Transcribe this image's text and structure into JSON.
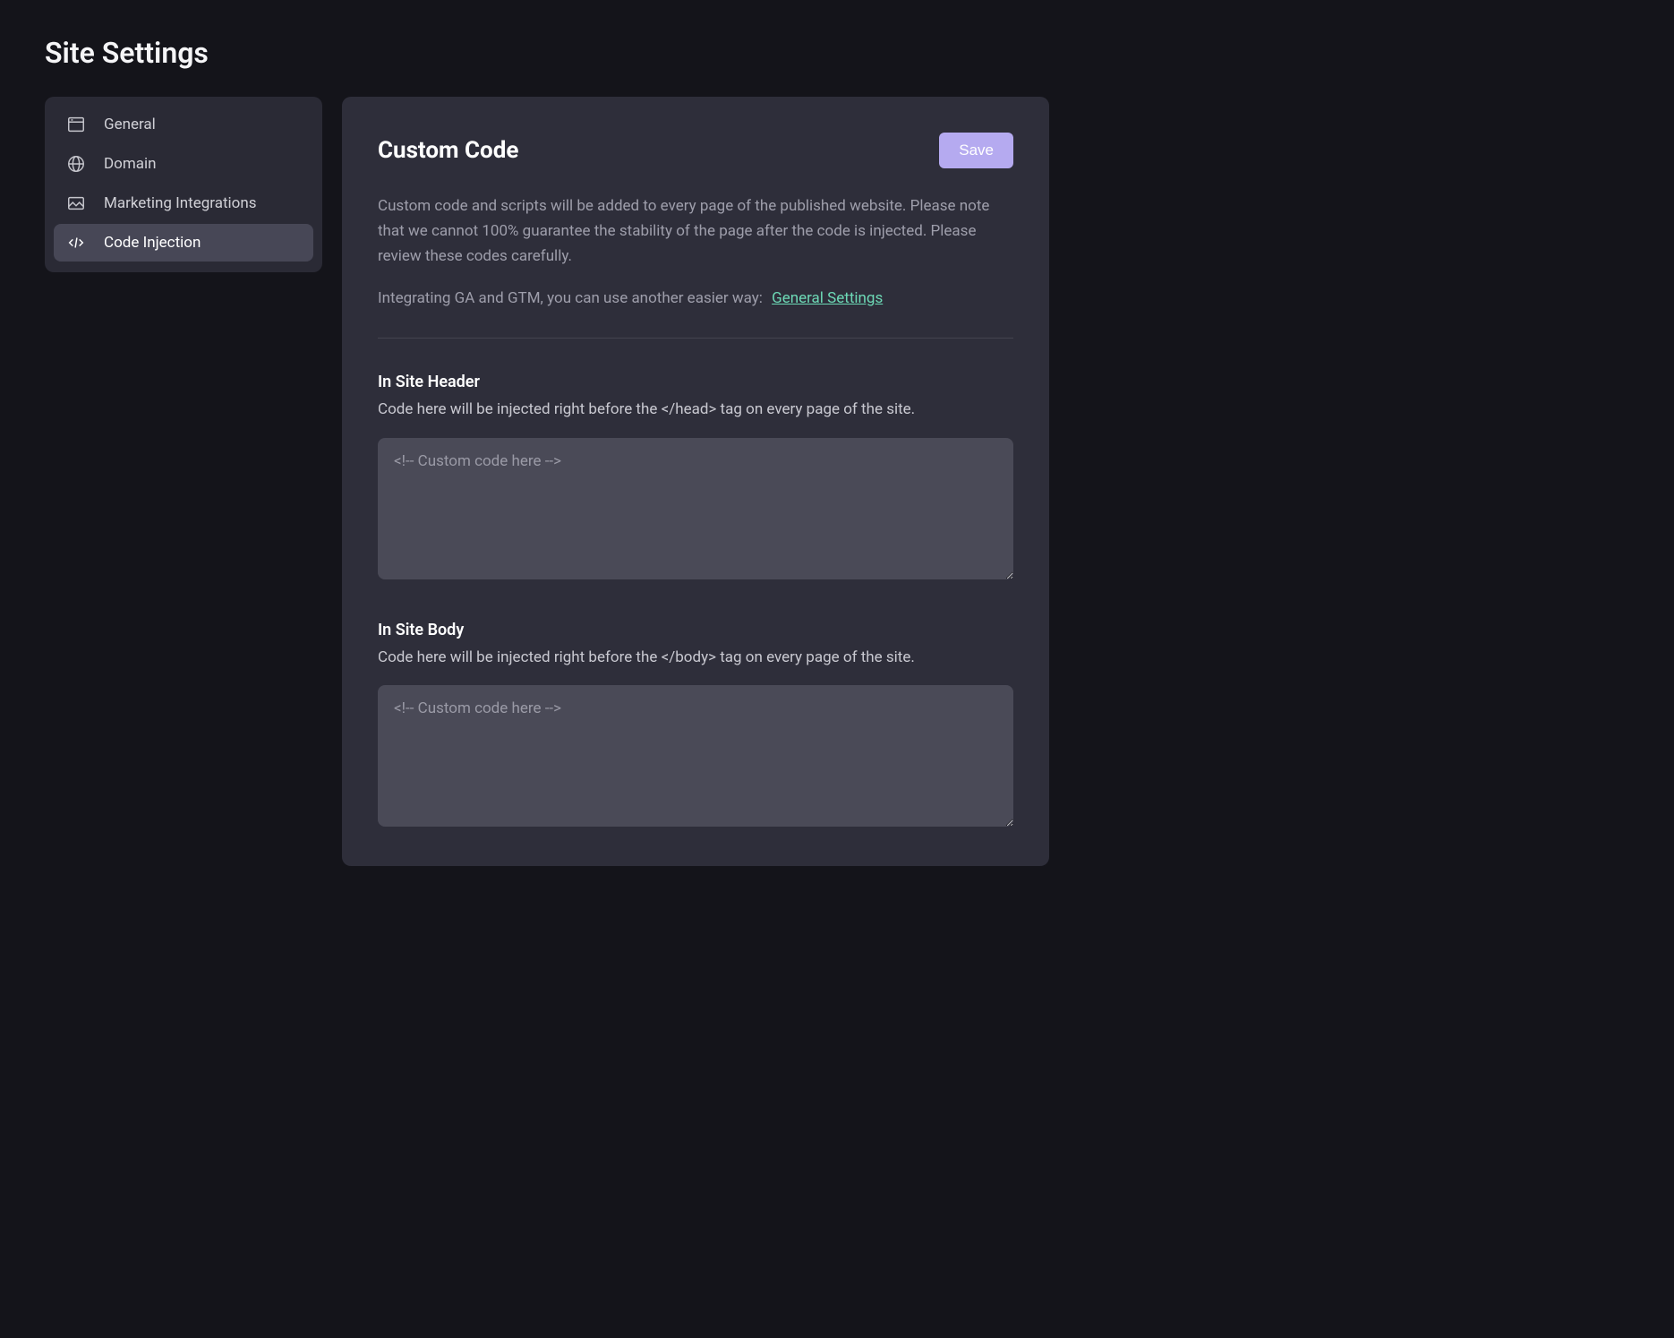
{
  "page": {
    "title": "Site Settings"
  },
  "sidebar": {
    "items": [
      {
        "label": "General"
      },
      {
        "label": "Domain"
      },
      {
        "label": "Marketing Integrations"
      },
      {
        "label": "Code Injection"
      }
    ]
  },
  "main": {
    "title": "Custom Code",
    "save_label": "Save",
    "description": "Custom code and scripts will be added to every page of the published website. Please note that we cannot 100% guarantee the stability of the page after the code is injected. Please review these codes carefully.",
    "hint_text": "Integrating GA and GTM, you can use another easier way:",
    "hint_link_label": "General Settings",
    "sections": [
      {
        "title": "In Site Header",
        "description": "Code here will be injected right before the </head> tag on every page of the site.",
        "placeholder": "<!-- Custom code here -->",
        "value": ""
      },
      {
        "title": "In Site Body",
        "description": "Code here will be injected right before the </body> tag on every page of the site.",
        "placeholder": "<!-- Custom code here -->",
        "value": ""
      }
    ]
  }
}
